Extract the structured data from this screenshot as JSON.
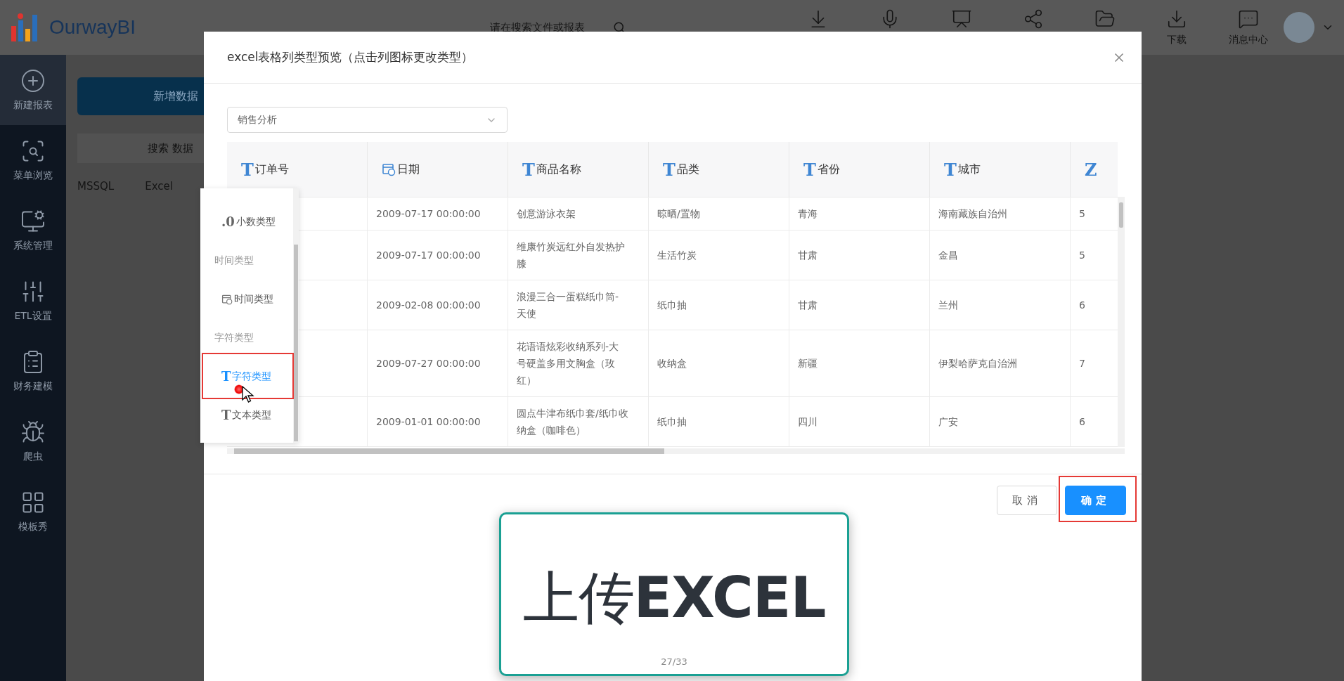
{
  "topbar": {
    "logo": "OurwayBI",
    "search": {
      "placeholder": "请在搜索文件或报表"
    },
    "tool_labels": [
      "下载",
      "消息中心"
    ]
  },
  "sidebar": {
    "items": [
      {
        "label": "新建报表",
        "selected": true
      },
      {
        "label": "菜单浏览",
        "selected": false
      },
      {
        "label": "系统管理",
        "selected": false
      },
      {
        "label": "ETL设置",
        "selected": false
      },
      {
        "label": "财务建模",
        "selected": false
      },
      {
        "label": "爬虫",
        "selected": false
      },
      {
        "label": "模板秀",
        "selected": false
      }
    ]
  },
  "background": {
    "add_button": "新增数据",
    "search": {
      "placeholder": "搜索 数据"
    },
    "tabs": [
      "MSSQL",
      "Excel"
    ]
  },
  "dialog": {
    "title": "excel表格列类型预览（点击列图标更改类型）",
    "sheet_select": "销售分析",
    "table": {
      "columns": [
        {
          "kind": "glyph",
          "icon": "T",
          "label": "订单号"
        },
        {
          "kind": "date",
          "label": "日期"
        },
        {
          "kind": "glyph",
          "icon": "T",
          "label": "商品名称"
        },
        {
          "kind": "glyph",
          "icon": "T",
          "label": "品类"
        },
        {
          "kind": "glyph",
          "icon": "T",
          "label": "省份"
        },
        {
          "kind": "glyph",
          "icon": "T",
          "label": "城市"
        },
        {
          "kind": "glyph",
          "icon": "Z"
        }
      ],
      "rows": [
        [
          "",
          "2009-07-17 00:00:00",
          "创意游泳衣架",
          "晾晒/置物",
          "青海",
          "海南藏族自治州",
          "5"
        ],
        [
          "",
          "2009-07-17 00:00:00",
          "维康竹炭远红外自发热护膝",
          "生活竹炭",
          "甘肃",
          "金昌",
          "5"
        ],
        [
          "",
          "2009-02-08 00:00:00",
          "浪漫三合一蛋糕纸巾筒-天使",
          "纸巾抽",
          "甘肃",
          "兰州",
          "6"
        ],
        [
          "",
          "2009-07-27 00:00:00",
          "花语语炫彩收纳系列-大号硬盖多用文胸盒（玫红）",
          "收纳盒",
          "新疆",
          "伊梨哈萨克自治洲",
          "7"
        ],
        [
          "",
          "2009-01-01 00:00:00",
          "圆点牛津布纸巾套/纸巾收纳盒（咖啡色）",
          "纸巾抽",
          "四川",
          "广安",
          "6"
        ]
      ]
    },
    "type_menu": [
      {
        "kind": "option",
        "icon": ".0",
        "label": "小数类型",
        "selected": false
      },
      {
        "kind": "group",
        "label": "时间类型"
      },
      {
        "kind": "date_option",
        "label": "时间类型",
        "selected": false
      },
      {
        "kind": "group",
        "label": "字符类型"
      },
      {
        "kind": "option",
        "icon": "T",
        "label": "字符类型",
        "selected": true
      },
      {
        "kind": "option",
        "icon": "T",
        "label": "文本类型",
        "selected": false
      }
    ],
    "buttons": [
      {
        "kind": "default",
        "label": "取消"
      },
      {
        "kind": "primary",
        "label": "确定"
      }
    ]
  },
  "slide": {
    "heading": "上传**EXCEL**",
    "page": "27/33"
  }
}
